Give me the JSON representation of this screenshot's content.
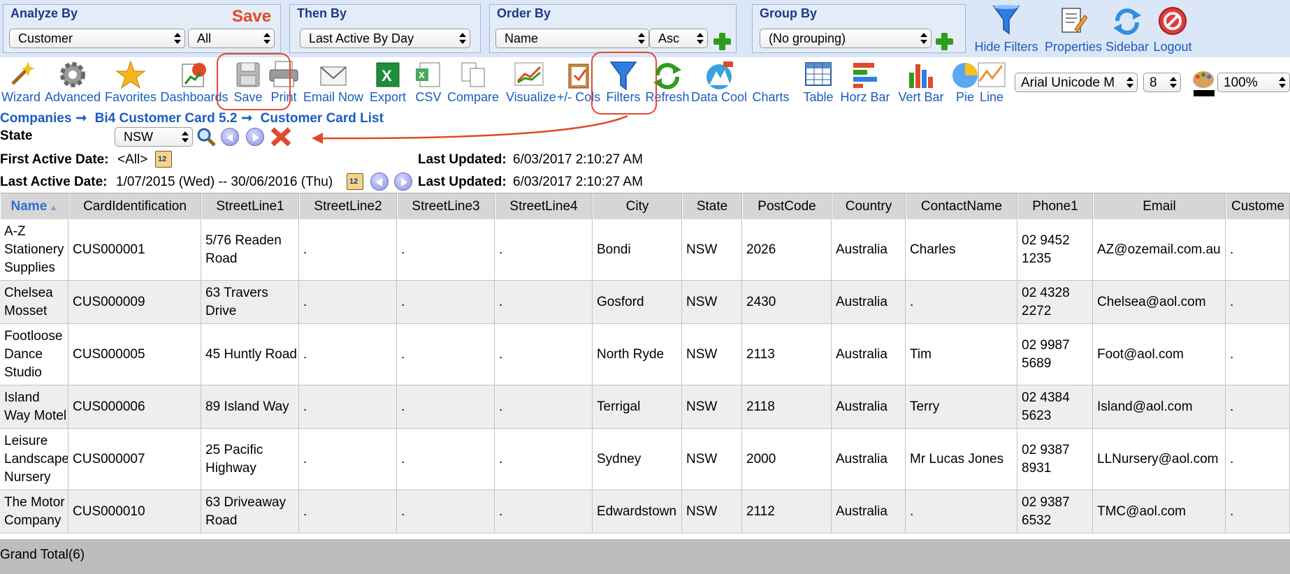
{
  "filters": {
    "analyze_by": {
      "title": "Analyze By",
      "field": "Customer",
      "value": "All"
    },
    "then_by": {
      "title": "Then By",
      "field": "Last Active By Day"
    },
    "order_by": {
      "title": "Order By",
      "field": "Name",
      "direction": "Asc"
    },
    "group_by": {
      "title": "Group By",
      "field": "(No grouping)"
    },
    "save_note": "Save"
  },
  "top_actions": [
    "Hide Filters",
    "Properties",
    "Sidebar",
    "Logout"
  ],
  "toolbar": {
    "items": [
      "Wizard",
      "Advanced",
      "Favorites",
      "Dashboards",
      "Save",
      "Print",
      "Email Now",
      "Export",
      "CSV",
      "Compare",
      "Visualize",
      "+/- Cols",
      "Filters",
      "Refresh",
      "Data Cool",
      "Charts",
      "Table",
      "Horz Bar",
      "Vert Bar",
      "Pie",
      "Line"
    ],
    "font": "Arial Unicode M",
    "font_size": "8",
    "zoom": "100%"
  },
  "breadcrumb": [
    "Companies",
    "Bi4 Customer Card 5.2",
    "Customer Card List"
  ],
  "criteria": {
    "state_label": "State",
    "state_value": "NSW",
    "first_active_label": "First Active Date:",
    "first_active_value": "<All>",
    "last_active_label": "Last Active Date:",
    "last_active_value": "1/07/2015 (Wed) -- 30/06/2016 (Thu)",
    "last_updated_label": "Last Updated:",
    "last_updated_value": "6/03/2017 2:10:27 AM"
  },
  "table": {
    "columns": [
      "Name",
      "CardIdentification",
      "StreetLine1",
      "StreetLine2",
      "StreetLine3",
      "StreetLine4",
      "City",
      "State",
      "PostCode",
      "Country",
      "ContactName",
      "Phone1",
      "Email",
      "Custome"
    ],
    "rows": [
      {
        "name": "A-Z Stationery Supplies",
        "card": "CUS000001",
        "street1": "5/76 Readen Road",
        "street2": ".",
        "street3": ".",
        "street4": ".",
        "city": "Bondi",
        "state": "NSW",
        "postcode": "2026",
        "country": "Australia",
        "contact": "Charles",
        "phone": "02 9452 1235",
        "email": "AZ@ozemail.com.au",
        "extra": "."
      },
      {
        "name": "Chelsea Mosset",
        "card": "CUS000009",
        "street1": "63 Travers Drive",
        "street2": ".",
        "street3": ".",
        "street4": ".",
        "city": "Gosford",
        "state": "NSW",
        "postcode": "2430",
        "country": "Australia",
        "contact": ".",
        "phone": "02 4328 2272",
        "email": "Chelsea@aol.com",
        "extra": "."
      },
      {
        "name": "Footloose Dance Studio",
        "card": "CUS000005",
        "street1": "45 Huntly Road",
        "street2": ".",
        "street3": ".",
        "street4": ".",
        "city": "North Ryde",
        "state": "NSW",
        "postcode": "2113",
        "country": "Australia",
        "contact": "Tim",
        "phone": "02 9987 5689",
        "email": "Foot@aol.com",
        "extra": "."
      },
      {
        "name": "Island Way Motel",
        "card": "CUS000006",
        "street1": "89 Island Way",
        "street2": ".",
        "street3": ".",
        "street4": ".",
        "city": "Terrigal",
        "state": "NSW",
        "postcode": "2118",
        "country": "Australia",
        "contact": "Terry",
        "phone": "02 4384 5623",
        "email": "Island@aol.com",
        "extra": "."
      },
      {
        "name": "Leisure Landscape Nursery",
        "card": "CUS000007",
        "street1": "25 Pacific Highway",
        "street2": ".",
        "street3": ".",
        "street4": ".",
        "city": "Sydney",
        "state": "NSW",
        "postcode": "2000",
        "country": "Australia",
        "contact": "Mr Lucas Jones",
        "phone": "02 9387 8931",
        "email": "LLNursery@aol.com",
        "extra": "."
      },
      {
        "name": "The Motor Company",
        "card": "CUS000010",
        "street1": "63 Driveaway Road",
        "street2": ".",
        "street3": ".",
        "street4": ".",
        "city": "Edwardstown",
        "state": "NSW",
        "postcode": "2112",
        "country": "Australia",
        "contact": ".",
        "phone": "02 9387 6532",
        "email": "TMC@aol.com",
        "extra": "."
      }
    ],
    "grand_total": "Grand Total(6)"
  }
}
